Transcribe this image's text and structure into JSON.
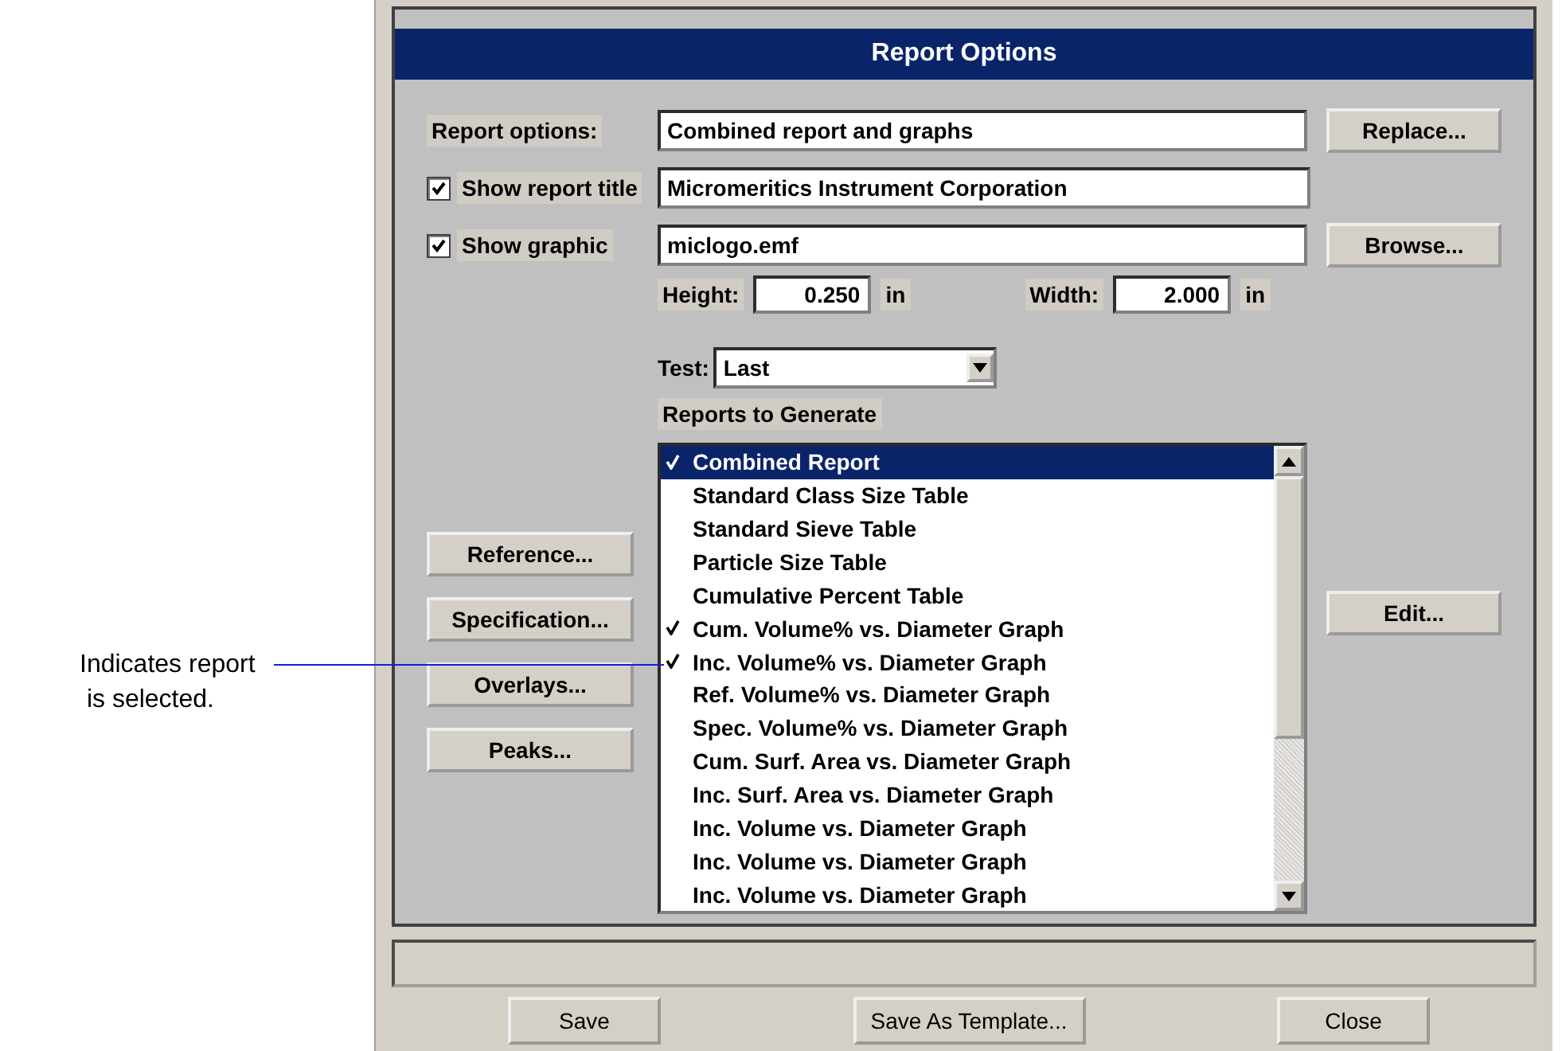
{
  "dialog": {
    "title": "Report Options"
  },
  "report_options": {
    "label": "Report options:",
    "value": "Combined report and graphs",
    "button": "Replace..."
  },
  "show_report_title": {
    "label": "Show report title",
    "checked": true,
    "value": "Micromeritics Instrument Corporation"
  },
  "show_graphic": {
    "label": "Show graphic",
    "checked": true,
    "value": "miclogo.emf",
    "button": "Browse..."
  },
  "height": {
    "label": "Height:",
    "value": "0.250",
    "unit": "in"
  },
  "width": {
    "label": "Width:",
    "value": "2.000",
    "unit": "in"
  },
  "test": {
    "label": "Test:",
    "value": "Last"
  },
  "reports": {
    "label": "Reports to Generate",
    "items": [
      {
        "label": "Combined Report",
        "checked": true,
        "selected": true
      },
      {
        "label": "Standard Class Size Table",
        "checked": false,
        "selected": false
      },
      {
        "label": "Standard Sieve Table",
        "checked": false,
        "selected": false
      },
      {
        "label": "Particle Size Table",
        "checked": false,
        "selected": false
      },
      {
        "label": "Cumulative Percent Table",
        "checked": false,
        "selected": false
      },
      {
        "label": "Cum. Volume% vs. Diameter Graph",
        "checked": true,
        "selected": false
      },
      {
        "label": "Inc. Volume% vs. Diameter Graph",
        "checked": true,
        "selected": false
      },
      {
        "label": "Ref. Volume% vs. Diameter Graph",
        "checked": false,
        "selected": false
      },
      {
        "label": "Spec. Volume% vs. Diameter Graph",
        "checked": false,
        "selected": false
      },
      {
        "label": "Cum. Surf. Area vs. Diameter Graph",
        "checked": false,
        "selected": false
      },
      {
        "label": "Inc. Surf. Area vs. Diameter Graph",
        "checked": false,
        "selected": false
      },
      {
        "label": "Inc. Volume vs. Diameter Graph",
        "checked": false,
        "selected": false
      },
      {
        "label": "Inc. Volume vs. Diameter Graph",
        "checked": false,
        "selected": false
      },
      {
        "label": "Inc. Volume vs. Diameter Graph",
        "checked": false,
        "selected": false
      }
    ]
  },
  "side_buttons": [
    "Reference...",
    "Specification...",
    "Overlays...",
    "Peaks..."
  ],
  "edit_button": "Edit...",
  "buttons": [
    "Save",
    "Save As Template...",
    "Close"
  ],
  "callout": {
    "text": "Indicates report\n is selected."
  }
}
